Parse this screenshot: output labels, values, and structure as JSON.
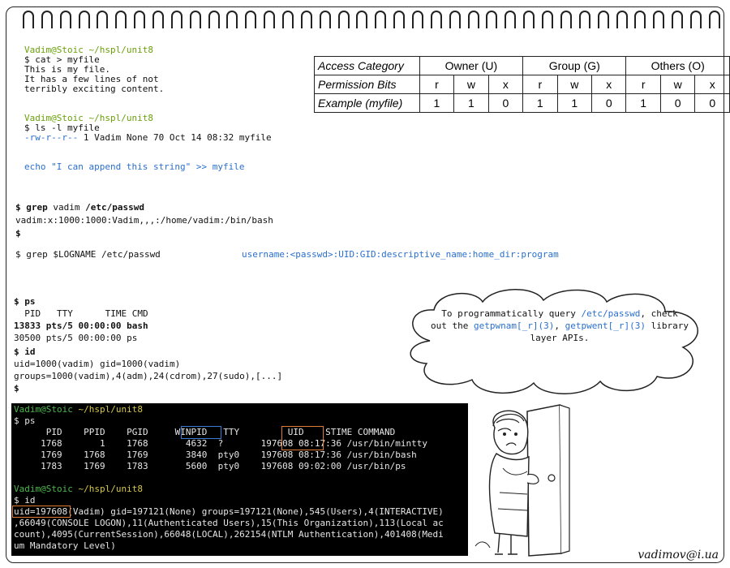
{
  "block1": {
    "prompt1": "Vadim@Stoic",
    "path1": "~/hspl/unit8",
    "cmd1": "$ cat > myfile",
    "out1": "This is my file.",
    "out2": "It has a few lines of not",
    "out3": "terribly exciting content.",
    "prompt2": "Vadim@Stoic",
    "path2": "~/hspl/unit8",
    "cmd2": "$ ls -l myfile",
    "perm_str": "-rw-r--r--",
    "ls_rest": " 1 Vadim None 70 Oct 14 08:32 myfile",
    "echo_cmd": "echo \"I can append this string\" >> myfile"
  },
  "perm_table": {
    "headers": [
      "Access Category",
      "Owner (U)",
      "Group (G)",
      "Others (O)"
    ],
    "row2_label": "Permission Bits",
    "row2": [
      "r",
      "w",
      "x",
      "r",
      "w",
      "x",
      "r",
      "w",
      "x"
    ],
    "row3_label": "Example (myfile)",
    "row3": [
      "1",
      "1",
      "0",
      "1",
      "1",
      "0",
      "1",
      "0",
      "0"
    ]
  },
  "block2": {
    "grep1_a": "$ grep",
    "grep1_b": " vadim ",
    "grep1_c": "/etc/passwd",
    "grep1_out": "vadim:x:1000:1000:Vadim,,,:/home/vadim:/bin/bash",
    "dollar": "$",
    "grep2": "$ grep $LOGNAME /etc/passwd",
    "passwd_fmt": "username:<passwd>:UID:GID:descriptive_name:home_dir:program"
  },
  "block3": {
    "ps_cmd": "$ ps",
    "ps_hdr": "  PID   TTY      TIME CMD",
    "ps_row1": "13833 pts/5 00:00:00 bash",
    "ps_row2": "30500 pts/5 00:00:00 ps",
    "id_cmd": "$ id",
    "id_out1": "uid=1000(vadim) gid=1000(vadim)",
    "id_out2": "groups=1000(vadim),4(adm),24(cdrom),27(sudo),[...]",
    "dollar": "$"
  },
  "cloud": {
    "t1": "To programmatically query ",
    "t2": "/etc/passwd",
    "t3": ", check",
    "t4": "out the ",
    "t5": "getpwnam[_r](3)",
    "t6": ", ",
    "t7": "getpwent[_r](3)",
    "t8": " library",
    "t9": "layer APIs."
  },
  "terminal": {
    "p1": "Vadim@Stoic",
    "path1": " ~/hspl/unit8",
    "c1": "$ ps",
    "hdr": "      PID    PPID    PGID     WINPID   TTY         UID    STIME COMMAND",
    "r1": "     1768       1    1768       4632  ?       197608 08:17:36 /usr/bin/mintty",
    "r2": "     1769    1768    1769       3840  pty0    197608 08:17:36 /usr/bin/bash",
    "r3": "     1783    1769    1783       5600  pty0    197608 09:02:00 /usr/bin/ps",
    "p2": "Vadim@Stoic",
    "path2": " ~/hspl/unit8",
    "c2": "$ id",
    "id1": "uid=197608(Vadim) gid=197121(None) groups=197121(None),545(Users),4(INTERACTIVE)",
    "id2": ",66049(CONSOLE LOGON),11(Authenticated Users),15(This Organization),113(Local ac",
    "id3": "count),4095(CurrentSession),66048(LOCAL),262154(NTLM Authentication),401408(Medi",
    "id4": "um Mandatory Level)"
  },
  "signature": "vadimov@i.ua"
}
